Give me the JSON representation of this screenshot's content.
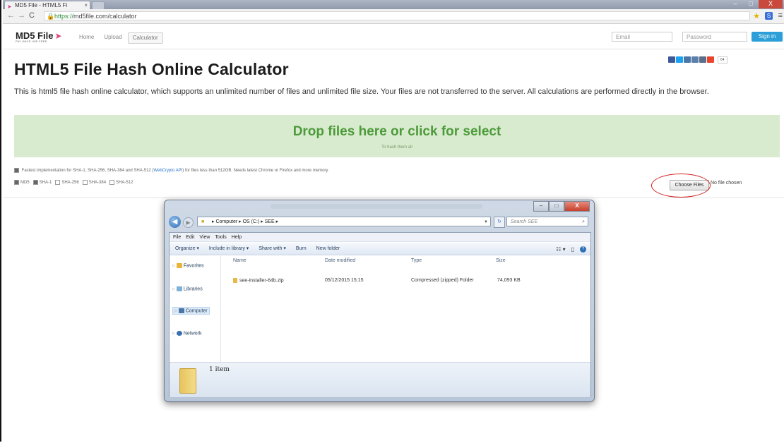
{
  "browser": {
    "tab_title": "MD5 File - HTML5 Fi",
    "tab_close": "×",
    "url_scheme": "https://",
    "url_rest": "md5file.com/calculator",
    "window_buttons": [
      "–",
      "□",
      "X"
    ],
    "extension_label": "S"
  },
  "site": {
    "logo_text": "MD5 File",
    "logo_tagline": "PAY ONCE USE FREE",
    "nav": [
      "Home",
      "Upload",
      "Calculator"
    ],
    "email_placeholder": "Email",
    "password_placeholder": "Password",
    "signin_label": "Sign in",
    "social_count": "64"
  },
  "page": {
    "title": "HTML5 File Hash Online Calculator",
    "intro": "This is html5 file hash online calculator, which supports an unlimited number of files and unlimited file size. Your files are not transferred to the server. All calculations are performed directly in the browser.",
    "drop_title": "Drop files here or click for select",
    "drop_subtitle": "To hash them all",
    "option_fast_pre": "Fastest implementation for SHA-1, SHA-256, SHA-384 and SHA-512 (",
    "option_fast_link": "WebCrypto API",
    "option_fast_post": ") for files less than 512GB. Needs latest Chrome or Firefox and more memory.",
    "hash_options": [
      {
        "label": "MD5",
        "checked": true
      },
      {
        "label": "SHA-1",
        "checked": true
      },
      {
        "label": "SHA-256",
        "checked": false
      },
      {
        "label": "SHA-384",
        "checked": false
      },
      {
        "label": "SHA-512",
        "checked": false
      }
    ],
    "choose_files": "Choose Files",
    "no_file": "No file chosen",
    "highlight_color": "#d21f1f"
  },
  "explorer": {
    "breadcrumb": "▸ Computer ▸ OS (C:) ▸ SEE ▸",
    "search_placeholder": "Search SEE",
    "menu": [
      "File",
      "Edit",
      "View",
      "Tools",
      "Help"
    ],
    "commands": [
      "Organize ▾",
      "Include in library ▾",
      "Share with ▾",
      "Burn",
      "New folder"
    ],
    "nav_items": [
      "Favorites",
      "Libraries",
      "Computer",
      "Network"
    ],
    "columns": [
      "Name",
      "Date modified",
      "Type",
      "Size"
    ],
    "file": {
      "name": "see-installer-64b.zip",
      "date": "05/12/2015 15:15",
      "type": "Compressed (zipped) Folder",
      "size": "74,093 KB"
    },
    "item_count": "1 item",
    "controls": [
      "–",
      "□",
      "X"
    ]
  }
}
